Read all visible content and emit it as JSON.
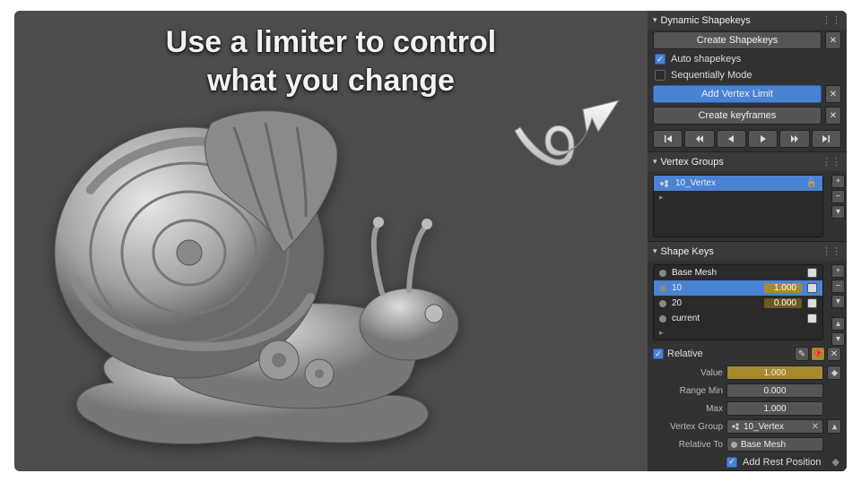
{
  "headline": {
    "line1": "Use a limiter to control",
    "line2": "what you change"
  },
  "panels": {
    "dynamic": {
      "title": "Dynamic Shapekeys",
      "create_shapekeys": "Create Shapekeys",
      "auto_shapekeys": "Auto shapekeys",
      "sequentially": "Sequentially Mode",
      "add_vertex_limit": "Add Vertex Limit",
      "create_keyframes": "Create keyframes"
    },
    "vertex_groups": {
      "title": "Vertex Groups",
      "items": [
        {
          "name": "10_Vertex"
        }
      ]
    },
    "shape_keys": {
      "title": "Shape Keys",
      "items": [
        {
          "name": "Base Mesh",
          "value": "",
          "selected": false
        },
        {
          "name": "10",
          "value": "1.000",
          "selected": true
        },
        {
          "name": "20",
          "value": "0.000",
          "selected": false
        },
        {
          "name": "current",
          "value": "",
          "selected": false
        }
      ],
      "relative": "Relative",
      "props": {
        "value_label": "Value",
        "value": "1.000",
        "range_min_label": "Range Min",
        "range_min": "0.000",
        "max_label": "Max",
        "max": "1.000",
        "vertex_group_label": "Vertex Group",
        "vertex_group": "10_Vertex",
        "relative_to_label": "Relative To",
        "relative_to": "Base Mesh",
        "add_rest": "Add Rest Position"
      }
    }
  }
}
